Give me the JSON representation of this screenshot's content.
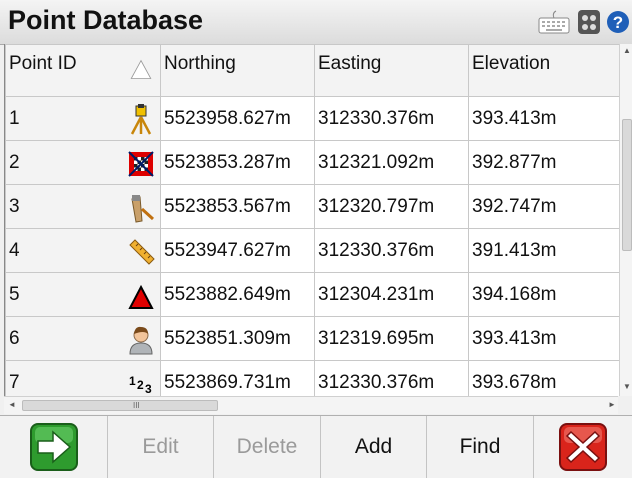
{
  "title": "Point Database",
  "columns": [
    "Point ID",
    "Northing",
    "Easting",
    "Elevation"
  ],
  "rows": [
    {
      "id": "1",
      "northing": "5523958.627m",
      "easting": "312330.376m",
      "elevation": "393.413m",
      "icon": "total-station-icon"
    },
    {
      "id": "2",
      "northing": "5523853.287m",
      "easting": "312321.092m",
      "elevation": "392.877m",
      "icon": "checkered-target-icon"
    },
    {
      "id": "3",
      "northing": "5523853.567m",
      "easting": "312320.797m",
      "elevation": "392.747m",
      "icon": "stake-icon"
    },
    {
      "id": "4",
      "northing": "5523947.627m",
      "easting": "312330.376m",
      "elevation": "391.413m",
      "icon": "measuring-rod-icon"
    },
    {
      "id": "5",
      "northing": "5523882.649m",
      "easting": "312304.231m",
      "elevation": "394.168m",
      "icon": "red-triangle-icon"
    },
    {
      "id": "6",
      "northing": "5523851.309m",
      "easting": "312319.695m",
      "elevation": "393.413m",
      "icon": "person-icon"
    },
    {
      "id": "7",
      "northing": "5523869.731m",
      "easting": "312330.376m",
      "elevation": "393.678m",
      "icon": "numbers-123-icon"
    }
  ],
  "numbers_glyph": "123",
  "buttons": {
    "edit": "Edit",
    "delete": "Delete",
    "add": "Add",
    "find": "Find"
  },
  "scroll_grip": "III",
  "colors": {
    "accept": "#2e9b2e",
    "cancel": "#d9241b"
  }
}
